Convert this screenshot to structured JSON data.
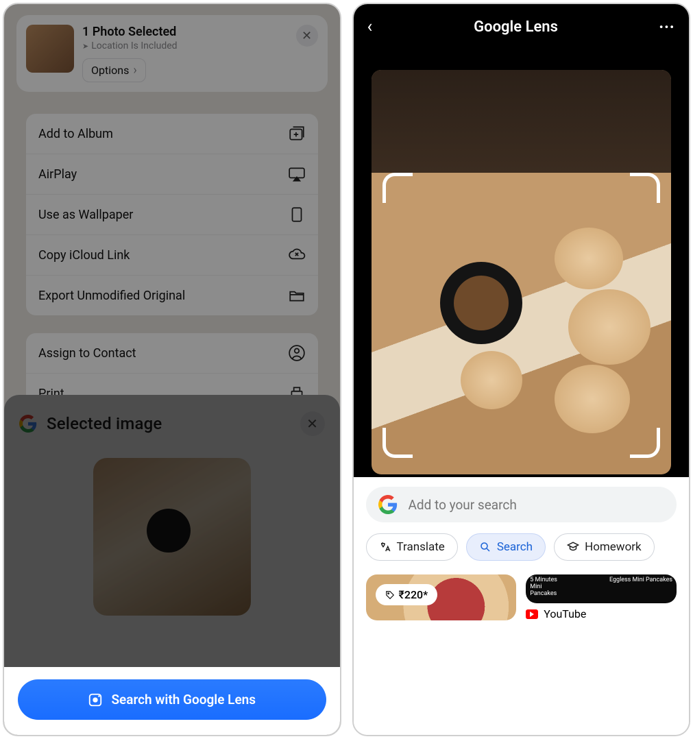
{
  "left": {
    "share": {
      "title": "1 Photo Selected",
      "subtitle": "Location Is Included",
      "options": "Options"
    },
    "actions": [
      {
        "label": "Add to Album",
        "icon": "album-add-icon"
      },
      {
        "label": "AirPlay",
        "icon": "airplay-icon"
      },
      {
        "label": "Use as Wallpaper",
        "icon": "wallpaper-icon"
      },
      {
        "label": "Copy iCloud Link",
        "icon": "icloud-link-icon"
      },
      {
        "label": "Export Unmodified Original",
        "icon": "folder-icon"
      }
    ],
    "actions2": [
      {
        "label": "Assign to Contact",
        "icon": "contact-icon"
      },
      {
        "label": "Print",
        "icon": "print-icon"
      }
    ],
    "sheet_title": "Selected image",
    "cta": "Search with Google Lens"
  },
  "right": {
    "brand": "Google Lens",
    "search_placeholder": "Add to your search",
    "chips": {
      "translate": "Translate",
      "search": "Search",
      "homework": "Homework"
    },
    "results": {
      "price": "₹220*",
      "card2_top_left": "5 Minutes\nMini\nPancakes",
      "card2_top_right": "Eggless Mini Pancakes",
      "source": "YouTube"
    }
  }
}
